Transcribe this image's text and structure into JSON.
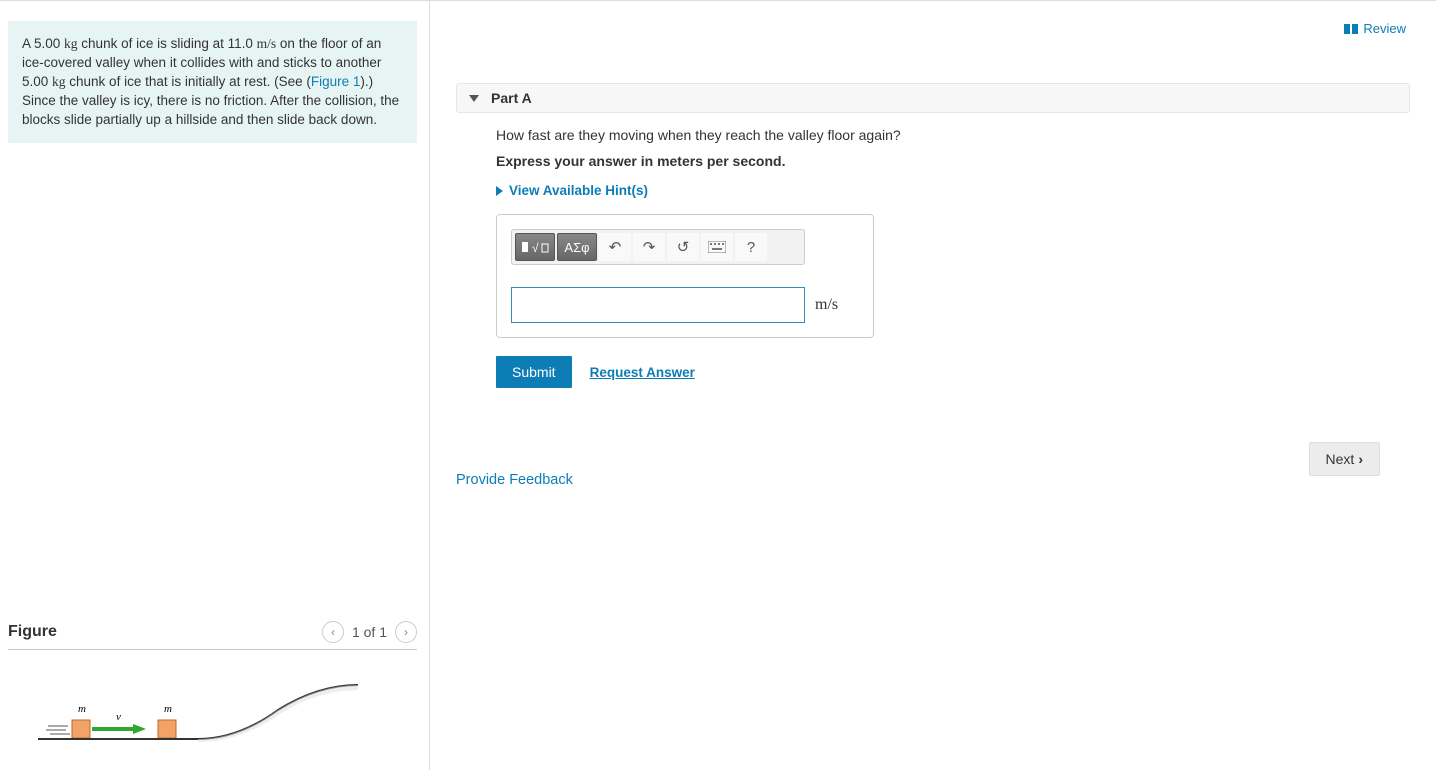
{
  "problem": {
    "text_pre": "A 5.00 ",
    "unit1": "kg",
    "text_2": " chunk of ice is sliding at 11.0 ",
    "unit2": "m/s",
    "text_3": " on the floor of an ice-covered valley when it collides with and sticks to another 5.00 ",
    "unit3": "kg",
    "text_4": " chunk of ice that is initially at rest. (See (",
    "figure_link": "Figure 1",
    "text_5": ").) Since the valley is icy, there is no friction. After the collision, the blocks slide partially up a hillside and then slide back down."
  },
  "figure": {
    "title": "Figure",
    "counter": "1 of 1",
    "labels": {
      "m1": "m",
      "m2": "m",
      "v": "v"
    }
  },
  "review_label": "Review",
  "part": {
    "title": "Part A",
    "question": "How fast are they moving when they reach the valley floor again?",
    "instruction": "Express your answer in meters per second.",
    "hints_label": "View Available Hint(s)",
    "unit_label": "m/s",
    "toolbar": {
      "templates": "√",
      "greek": "ΑΣφ",
      "undo": "↶",
      "redo": "↷",
      "reset": "↺",
      "keyboard": "⌨",
      "help": "?"
    },
    "submit": "Submit",
    "request": "Request Answer"
  },
  "feedback": "Provide Feedback",
  "next": "Next"
}
